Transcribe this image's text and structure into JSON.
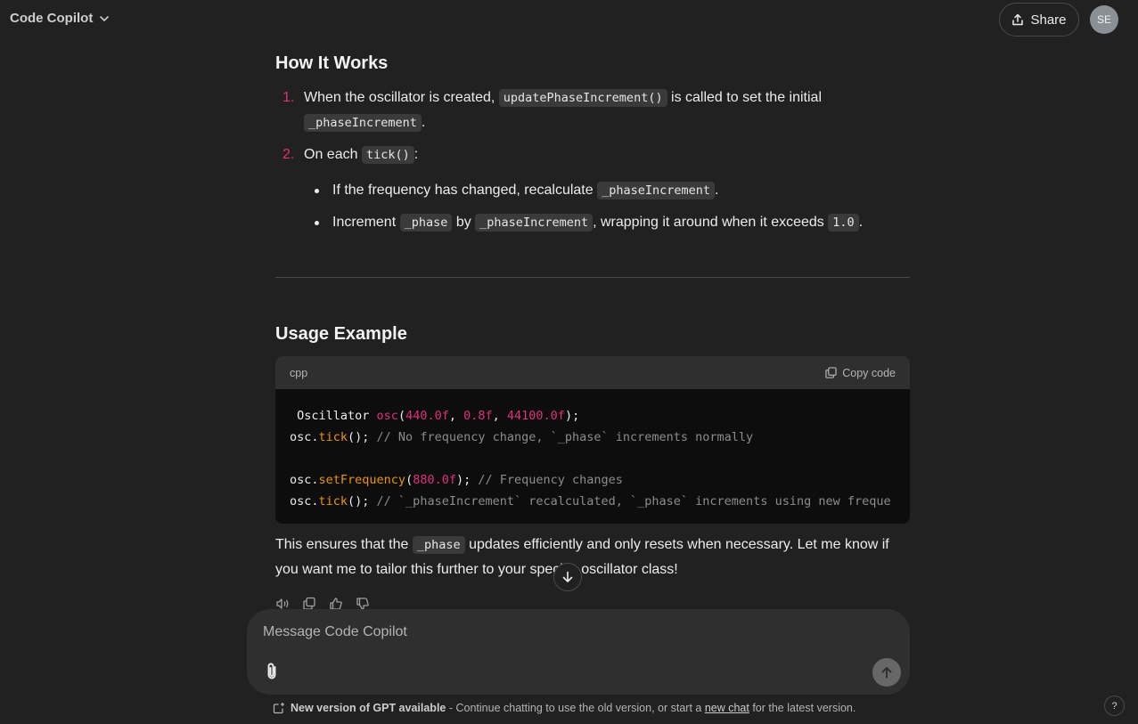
{
  "header": {
    "model_name": "Code Copilot",
    "share_label": "Share",
    "avatar_initials": "SE"
  },
  "message": {
    "section1_title": "How It Works",
    "ol": [
      {
        "num": "1.",
        "pre": "When the oscillator is created, ",
        "code1": "updatePhaseIncrement()",
        "mid": " is called to set the initial",
        "code2": "_phaseIncrement",
        "post": "."
      },
      {
        "num": "2.",
        "pre": "On each ",
        "code1": "tick()",
        "post": ":"
      }
    ],
    "bullets": [
      {
        "pre": "If the frequency has changed, recalculate ",
        "code1": "_phaseIncrement",
        "post": "."
      },
      {
        "pre": "Increment ",
        "code1": "_phase",
        "mid1": " by ",
        "code2": "_phaseIncrement",
        "mid2": ", wrapping it around when it exceeds ",
        "code3": "1.0",
        "post": "."
      }
    ],
    "section2_title": "Usage Example",
    "code_lang": "cpp",
    "copy_label": "Copy code",
    "code_lines": [
      "Oscillator osc(440.0f, 0.8f, 44100.0f);",
      "osc.tick(); // No frequency change, `_phase` increments normally",
      "",
      "osc.setFrequency(880.0f); // Frequency changes",
      "osc.tick(); // `_phaseIncrement` recalculated, `_phase` increments using new freque"
    ],
    "closing_pre": "This ensures that the ",
    "closing_code": "_phase",
    "closing_post": " updates efficiently and only resets when necessary. Let me know if you want me to tailor this further to your specific oscillator class!"
  },
  "composer": {
    "placeholder": "Message Code Copilot"
  },
  "footer": {
    "bold": "New version of GPT available",
    "text1": " - Continue chatting to use the old version, or start a ",
    "link": "new chat",
    "text2": " for the latest version.",
    "help": "?"
  },
  "icons": [
    "chevron-down-icon",
    "share-icon",
    "copy-icon",
    "speaker-icon",
    "thumbs-up-icon",
    "thumbs-down-icon",
    "arrow-down-icon",
    "paperclip-icon",
    "arrow-up-icon",
    "new-chat-icon"
  ]
}
